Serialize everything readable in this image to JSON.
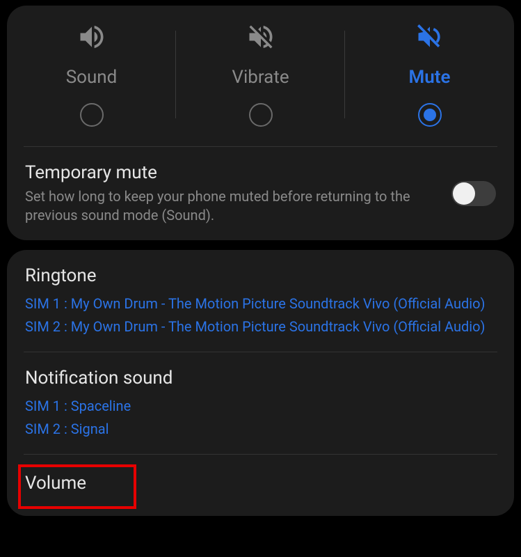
{
  "modes": {
    "sound": {
      "label": "Sound",
      "selected": false
    },
    "vibrate": {
      "label": "Vibrate",
      "selected": false
    },
    "mute": {
      "label": "Mute",
      "selected": true
    }
  },
  "temporary_mute": {
    "title": "Temporary mute",
    "description": "Set how long to keep your phone muted before returning to the previous sound mode (Sound).",
    "enabled": false
  },
  "ringtone": {
    "title": "Ringtone",
    "sim1": "SIM 1 : My Own Drum - The Motion Picture Soundtrack Vivo (Official Audio)",
    "sim2": "SIM 2 : My Own Drum - The Motion Picture Soundtrack Vivo (Official Audio)"
  },
  "notification_sound": {
    "title": "Notification sound",
    "sim1": "SIM 1 : Spaceline",
    "sim2": "SIM 2 : Signal"
  },
  "volume": {
    "title": "Volume"
  },
  "colors": {
    "accent": "#2b73e6",
    "highlight": "#e60000"
  }
}
